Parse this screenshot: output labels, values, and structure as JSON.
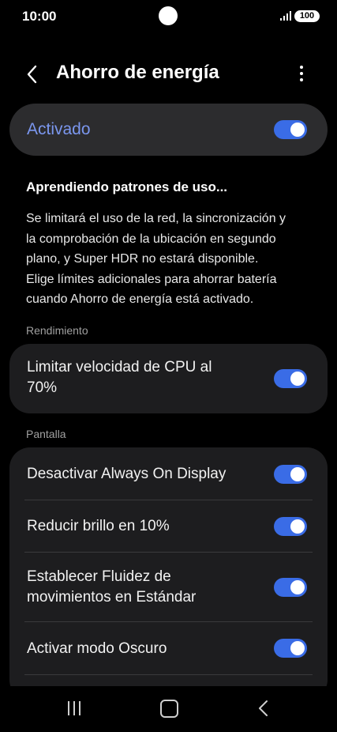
{
  "status_bar": {
    "time": "10:00",
    "battery": "100",
    "icons": [
      "camera-cutout-icon",
      "signal-icon",
      "battery-icon"
    ]
  },
  "header": {
    "title": "Ahorro de energía",
    "back_icon": "chevron-left-icon",
    "more_icon": "more-vertical-icon"
  },
  "master_switch": {
    "label": "Activado",
    "on": true
  },
  "learning": {
    "title": "Aprendiendo patrones de uso...",
    "description_lines": [
      "Se limitará el uso de la red, la sincronización y",
      "la comprobación de la ubicación en segundo",
      "plano, y Super HDR no estará disponible.",
      "Elige límites adicionales para ahorrar batería",
      "cuando Ahorro de energía está activado."
    ]
  },
  "sections": {
    "performance": {
      "label": "Rendimiento",
      "items": [
        {
          "label_lines": [
            "Limitar velocidad de CPU al",
            "70%"
          ],
          "on": true
        }
      ]
    },
    "display": {
      "label": "Pantalla",
      "items": [
        {
          "label": "Desactivar Always On Display",
          "on": true
        },
        {
          "label": "Reducir brillo en 10%",
          "on": true
        },
        {
          "label_lines": [
            "Establecer Fluidez de",
            "movimientos en Estándar"
          ],
          "on": true
        },
        {
          "label": "Activar modo Oscuro",
          "on": true
        }
      ]
    }
  },
  "nav_bar": {
    "icons": [
      "recent-apps-icon",
      "home-icon",
      "back-icon"
    ]
  },
  "colors": {
    "accent": "#3a6ce6",
    "accent_text": "#7b97ef",
    "card": "#1d1d1f",
    "background": "#000000"
  }
}
